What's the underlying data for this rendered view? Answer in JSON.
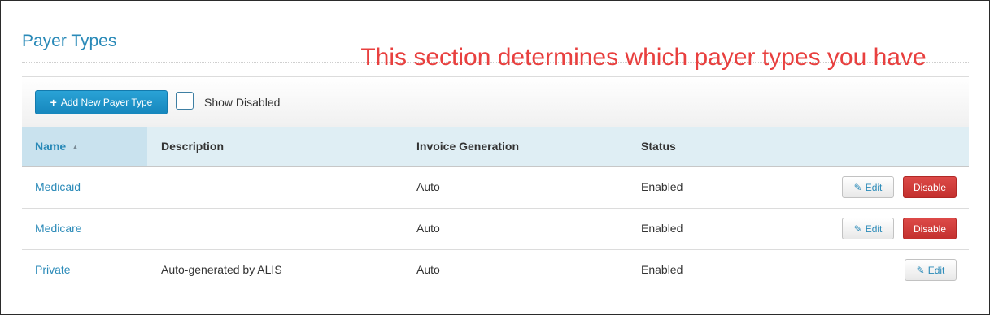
{
  "page": {
    "title": "Payer Types"
  },
  "annotation": {
    "line1": "This section determines which payer types you have",
    "line2": "available in the tabs at the top of Billing Settings."
  },
  "toolbar": {
    "add_icon": "plus-icon",
    "add_label": "Add New Payer Type",
    "show_disabled_label": "Show Disabled",
    "show_disabled_checked": false
  },
  "table": {
    "columns": {
      "name": "Name",
      "description": "Description",
      "invoice_generation": "Invoice Generation",
      "status": "Status"
    },
    "sort": {
      "column": "name",
      "icon": "sort-icon"
    },
    "rows": [
      {
        "name": "Medicaid",
        "description": "",
        "invoice_generation": "Auto",
        "status": "Enabled",
        "edit_label": "Edit",
        "disable_label": "Disable"
      },
      {
        "name": "Medicare",
        "description": "",
        "invoice_generation": "Auto",
        "status": "Enabled",
        "edit_label": "Edit",
        "disable_label": "Disable"
      },
      {
        "name": "Private",
        "description": "Auto-generated by ALIS",
        "invoice_generation": "Auto",
        "status": "Enabled",
        "edit_label": "Edit"
      }
    ]
  },
  "colors": {
    "accent": "#2a8ab8",
    "annotation": "#e8403f",
    "primary_button": "#1b93c9",
    "danger_button": "#d13b39",
    "header_bg": "#dfeef4"
  }
}
